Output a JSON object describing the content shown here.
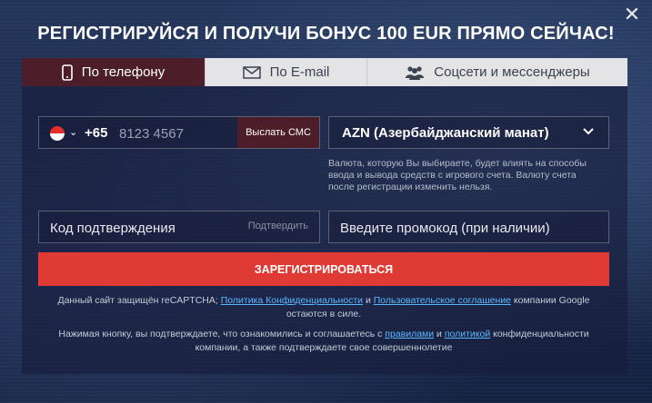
{
  "modal": {
    "title": "РЕГИСТРИРУЙСЯ И ПОЛУЧИ БОНУС 100 EUR ПРЯМО СЕЙЧАС!",
    "close_icon": "close-icon"
  },
  "tabs": [
    {
      "label": "По телефону",
      "icon": "phone-icon",
      "active": true
    },
    {
      "label": "По E-mail",
      "icon": "mail-icon",
      "active": false
    },
    {
      "label": "Соцсети и мессенджеры",
      "icon": "users-icon",
      "active": false
    }
  ],
  "phone": {
    "country_code": "+65",
    "placeholder": "8123 4567",
    "flag": "singapore-flag-icon",
    "send_sms_label": "Выслать СМС"
  },
  "currency": {
    "selected": "AZN (Азербайджанский манат)",
    "note": "Валюта, которую Вы выбираете, будет влиять на способы ввода и вывода средств с игрового счета. Валюту счета после регистрации изменить нельзя."
  },
  "confirm": {
    "placeholder": "Код подтверждения",
    "button_label": "Подтвердить"
  },
  "promo": {
    "placeholder": "Введите промокод (при наличии)"
  },
  "register_label": "ЗАРЕГИСТРИРОВАТЬСЯ",
  "legal": {
    "recaptcha_prefix": "Данный сайт защищён reCAPTCHA; ",
    "privacy_link": "Политика Конфиденциальности",
    "and": " и ",
    "terms_link": "Пользовательское соглашение",
    "recaptcha_suffix": " компании Google остаются в силе.",
    "agree_prefix": "Нажимая кнопку, вы подтверждаете, что ознакомились и соглашаетесь с ",
    "rules_link": "правилами",
    "and2": " и ",
    "policy_link": "политикой",
    "agree_suffix": " конфиденциальности компании, а также подтверждаете свое совершеннолетие"
  },
  "colors": {
    "accent": "#e03a34",
    "active_tab": "#4b1e2a",
    "link": "#58b8ff"
  }
}
